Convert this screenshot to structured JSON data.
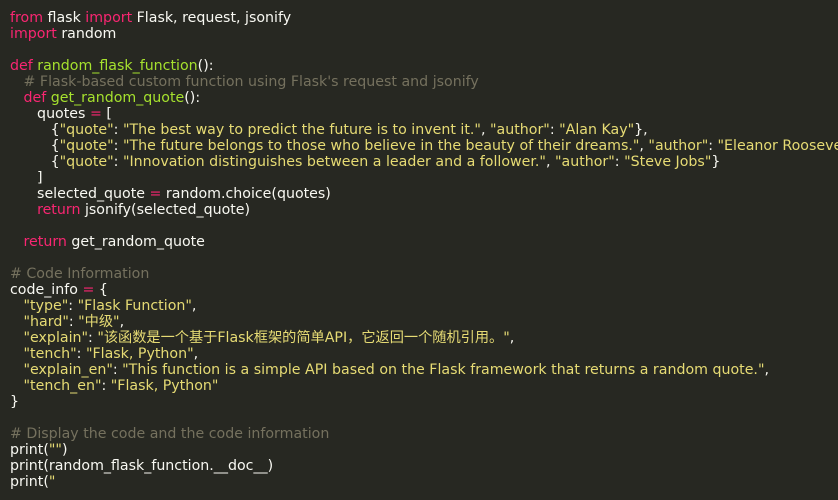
{
  "theme": {
    "background": "#272822",
    "text": "#f8f8f2",
    "keyword": "#f92672",
    "function": "#a6e22e",
    "string": "#e6db74",
    "comment": "#75715e"
  },
  "lines": [
    [
      [
        "kw",
        "from"
      ],
      [
        "tx",
        " flask "
      ],
      [
        "kw",
        "import"
      ],
      [
        "tx",
        " Flask, request, jsonify"
      ]
    ],
    [
      [
        "kw",
        "import"
      ],
      [
        "tx",
        " random"
      ]
    ],
    [],
    [
      [
        "kw",
        "def"
      ],
      [
        "tx",
        " "
      ],
      [
        "fn",
        "random_flask_function"
      ],
      [
        "tx",
        "():"
      ]
    ],
    [
      [
        "tx",
        "   "
      ],
      [
        "cm",
        "# Flask-based custom function using Flask's request and jsonify"
      ]
    ],
    [
      [
        "tx",
        "   "
      ],
      [
        "kw",
        "def"
      ],
      [
        "tx",
        " "
      ],
      [
        "fn",
        "get_random_quote"
      ],
      [
        "tx",
        "():"
      ]
    ],
    [
      [
        "tx",
        "      quotes "
      ],
      [
        "op",
        "="
      ],
      [
        "tx",
        " ["
      ]
    ],
    [
      [
        "tx",
        "         {"
      ],
      [
        "str",
        "\"quote\""
      ],
      [
        "tx",
        ": "
      ],
      [
        "str",
        "\"The best way to predict the future is to invent it.\""
      ],
      [
        "tx",
        ", "
      ],
      [
        "str",
        "\"author\""
      ],
      [
        "tx",
        ": "
      ],
      [
        "str",
        "\"Alan Kay\""
      ],
      [
        "tx",
        "},"
      ]
    ],
    [
      [
        "tx",
        "         {"
      ],
      [
        "str",
        "\"quote\""
      ],
      [
        "tx",
        ": "
      ],
      [
        "str",
        "\"The future belongs to those who believe in the beauty of their dreams.\""
      ],
      [
        "tx",
        ", "
      ],
      [
        "str",
        "\"author\""
      ],
      [
        "tx",
        ": "
      ],
      [
        "str",
        "\"Eleanor Roosevelt\""
      ],
      [
        "tx",
        "},"
      ]
    ],
    [
      [
        "tx",
        "         {"
      ],
      [
        "str",
        "\"quote\""
      ],
      [
        "tx",
        ": "
      ],
      [
        "str",
        "\"Innovation distinguishes between a leader and a follower.\""
      ],
      [
        "tx",
        ", "
      ],
      [
        "str",
        "\"author\""
      ],
      [
        "tx",
        ": "
      ],
      [
        "str",
        "\"Steve Jobs\""
      ],
      [
        "tx",
        "}"
      ]
    ],
    [
      [
        "tx",
        "      ]"
      ]
    ],
    [
      [
        "tx",
        "      selected_quote "
      ],
      [
        "op",
        "="
      ],
      [
        "tx",
        " random.choice(quotes)"
      ]
    ],
    [
      [
        "tx",
        "      "
      ],
      [
        "kw",
        "return"
      ],
      [
        "tx",
        " jsonify(selected_quote)"
      ]
    ],
    [],
    [
      [
        "tx",
        "   "
      ],
      [
        "kw",
        "return"
      ],
      [
        "tx",
        " get_random_quote"
      ]
    ],
    [],
    [
      [
        "cm",
        "# Code Information"
      ]
    ],
    [
      [
        "tx",
        "code_info "
      ],
      [
        "op",
        "="
      ],
      [
        "tx",
        " {"
      ]
    ],
    [
      [
        "tx",
        "   "
      ],
      [
        "str",
        "\"type\""
      ],
      [
        "tx",
        ": "
      ],
      [
        "str",
        "\"Flask Function\""
      ],
      [
        "tx",
        ","
      ]
    ],
    [
      [
        "tx",
        "   "
      ],
      [
        "str",
        "\"hard\""
      ],
      [
        "tx",
        ": "
      ],
      [
        "str",
        "\"中级\""
      ],
      [
        "tx",
        ","
      ]
    ],
    [
      [
        "tx",
        "   "
      ],
      [
        "str",
        "\"explain\""
      ],
      [
        "tx",
        ": "
      ],
      [
        "str",
        "\"该函数是一个基于Flask框架的简单API，它返回一个随机引用。\""
      ],
      [
        "tx",
        ","
      ]
    ],
    [
      [
        "tx",
        "   "
      ],
      [
        "str",
        "\"tench\""
      ],
      [
        "tx",
        ": "
      ],
      [
        "str",
        "\"Flask, Python\""
      ],
      [
        "tx",
        ","
      ]
    ],
    [
      [
        "tx",
        "   "
      ],
      [
        "str",
        "\"explain_en\""
      ],
      [
        "tx",
        ": "
      ],
      [
        "str",
        "\"This function is a simple API based on the Flask framework that returns a random quote.\""
      ],
      [
        "tx",
        ","
      ]
    ],
    [
      [
        "tx",
        "   "
      ],
      [
        "str",
        "\"tench_en\""
      ],
      [
        "tx",
        ": "
      ],
      [
        "str",
        "\"Flask, Python\""
      ]
    ],
    [
      [
        "tx",
        "}"
      ]
    ],
    [],
    [
      [
        "cm",
        "# Display the code and the code information"
      ]
    ],
    [
      [
        "tx",
        "print("
      ],
      [
        "str",
        "\"\""
      ],
      [
        "tx",
        ")"
      ]
    ],
    [
      [
        "tx",
        "print(random_flask_function.__doc__)"
      ]
    ],
    [
      [
        "tx",
        "print("
      ],
      [
        "str",
        "\""
      ]
    ]
  ]
}
